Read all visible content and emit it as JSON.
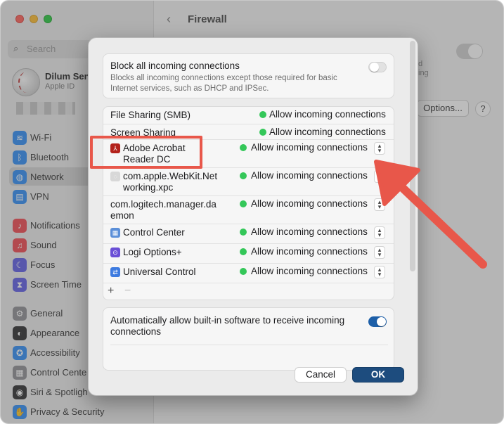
{
  "window": {
    "title": "Firewall",
    "back_icon": "chevron-left-icon"
  },
  "sidebar": {
    "search_placeholder": "Search",
    "user": {
      "name": "Dilum Sen",
      "subtitle": "Apple ID"
    },
    "items": [
      {
        "label": "Wi-Fi",
        "icon": "wifi-icon",
        "color": "#2f8df5"
      },
      {
        "label": "Bluetooth",
        "icon": "bluetooth-icon",
        "color": "#2f8df5"
      },
      {
        "label": "Network",
        "icon": "globe-icon",
        "color": "#2f8df5",
        "selected": true
      },
      {
        "label": "VPN",
        "icon": "vpn-icon",
        "color": "#2f8df5"
      },
      {
        "label": "Notifications",
        "icon": "bell-icon",
        "color": "#f0474f"
      },
      {
        "label": "Sound",
        "icon": "speaker-icon",
        "color": "#f0474f"
      },
      {
        "label": "Focus",
        "icon": "moon-icon",
        "color": "#5e5ce6"
      },
      {
        "label": "Screen Time",
        "icon": "hourglass-icon",
        "color": "#5e5ce6"
      },
      {
        "label": "General",
        "icon": "gear-icon",
        "color": "#8e8e93"
      },
      {
        "label": "Appearance",
        "icon": "appearance-icon",
        "color": "#2c2c2e"
      },
      {
        "label": "Accessibility",
        "icon": "accessibility-icon",
        "color": "#2f8df5"
      },
      {
        "label": "Control Cente",
        "icon": "control-center-icon",
        "color": "#8e8e93"
      },
      {
        "label": "Siri & Spotligh",
        "icon": "siri-icon",
        "color": "#2c2c2e"
      },
      {
        "label": "Privacy & Security",
        "icon": "hand-icon",
        "color": "#2f8df5"
      }
    ]
  },
  "background": {
    "options_label": "Options...",
    "help_label": "?",
    "fragment_1": "d",
    "fragment_2": "ing"
  },
  "sheet": {
    "block_all": {
      "title": "Block all incoming connections",
      "description": "Blocks all incoming connections except those required for basic Internet services, such as DHCP and IPSec.",
      "enabled": false
    },
    "apps": [
      {
        "name": "File Sharing (SMB)",
        "status": "Allow incoming connections",
        "stepper": false
      },
      {
        "name": "Screen Sharing",
        "status": "Allow incoming connections",
        "stepper": false
      },
      {
        "name": "Adobe Acrobat\nReader DC",
        "status": "Allow incoming connections",
        "stepper": true,
        "icon": "acrobat-icon"
      },
      {
        "name": "com.apple.WebKit.Net\nworking.xpc",
        "status": "Allow incoming connections",
        "stepper": true,
        "icon": "generic-app-icon"
      },
      {
        "name": "com.logitech.manager.da\nemon",
        "status": "Allow incoming connections",
        "stepper": true
      },
      {
        "name": "Control Center",
        "status": "Allow incoming connections",
        "stepper": true,
        "icon": "control-center-icon"
      },
      {
        "name": "Logi Options+",
        "status": "Allow incoming connections",
        "stepper": true,
        "icon": "logi-icon"
      },
      {
        "name": "Universal Control",
        "status": "Allow incoming connections",
        "stepper": true,
        "icon": "universal-control-icon"
      }
    ],
    "add_label": "+",
    "remove_label": "−",
    "auto_allow": {
      "title": "Automatically allow built-in software to receive incoming connections",
      "enabled": true
    },
    "cancel_label": "Cancel",
    "ok_label": "OK"
  },
  "colors": {
    "accent": "#1d4c7e",
    "status_green": "#34c759",
    "annotation_red": "#e8574a"
  }
}
